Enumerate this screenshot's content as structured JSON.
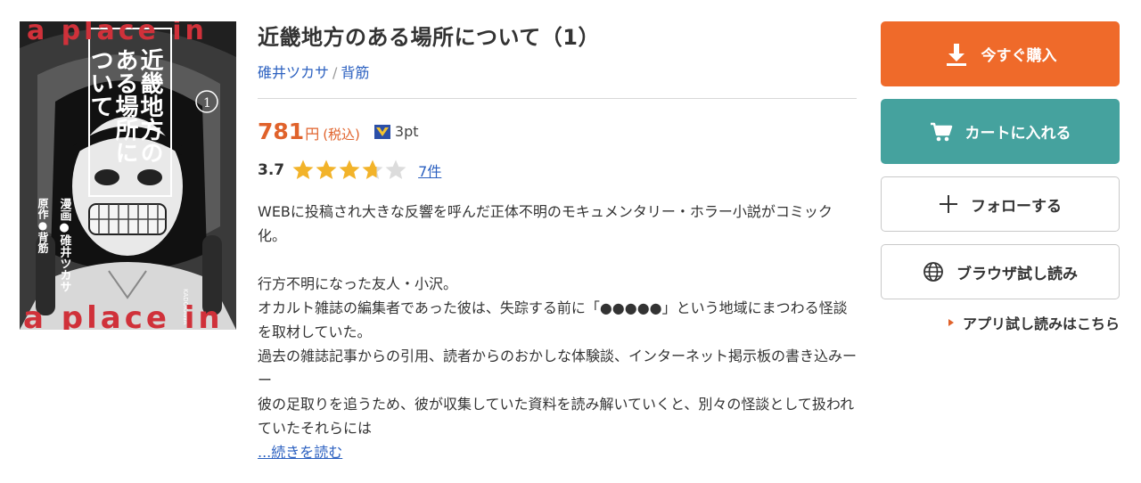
{
  "product": {
    "title": "近畿地方のある場所について（1）",
    "author_1": "碓井ツカサ",
    "author_sep": "/",
    "author_2": "背筋",
    "price": "781",
    "price_unit": "円",
    "tax_label": "(税込)",
    "points": "3pt",
    "rating": "3.7",
    "rating_value": 3.7,
    "rating_max": 5,
    "review_count": "7件"
  },
  "cover": {
    "top_text": "a place in",
    "bottom_text": "a place in",
    "title_col1": "近畿地方の",
    "title_col2": "ある場所に",
    "title_col3": "ついて",
    "volume": "1",
    "credit_1": "漫画●碓井ツカサ",
    "credit_2": "原作●背筋",
    "publisher": "KADOKAWA"
  },
  "description": {
    "p1": "WEBに投稿され大きな反響を呼んだ正体不明のモキュメンタリー・ホラー小説がコミック化。",
    "p2": "行方不明になった友人・小沢。",
    "p3": "オカルト雑誌の編集者であった彼は、失踪する前に「●●●●●」という地域にまつわる怪談を取材していた。",
    "p4": "過去の雑誌記事からの引用、読者からのおかしな体験談、インターネット掲示板の書き込みーー",
    "p5": "彼の足取りを追うため、彼が収集していた資料を読み解いていくと、別々の怪談として扱われていたそれらには",
    "more": "...続きを読む"
  },
  "actions": {
    "buy": "今すぐ購入",
    "cart": "カートに入れる",
    "follow": "フォローする",
    "trial": "ブラウザ試し読み",
    "app_trial": "アプリ試し読みはこちら"
  },
  "colors": {
    "buy": "#ef6a2a",
    "cart": "#45a29e",
    "link": "#2b60c0",
    "price": "#e0622b",
    "star": "#f2b32a"
  },
  "icons": {
    "buy": "download-icon",
    "cart": "cart-icon",
    "follow": "plus-icon",
    "trial": "globe-icon",
    "points": "point-badge-icon"
  }
}
